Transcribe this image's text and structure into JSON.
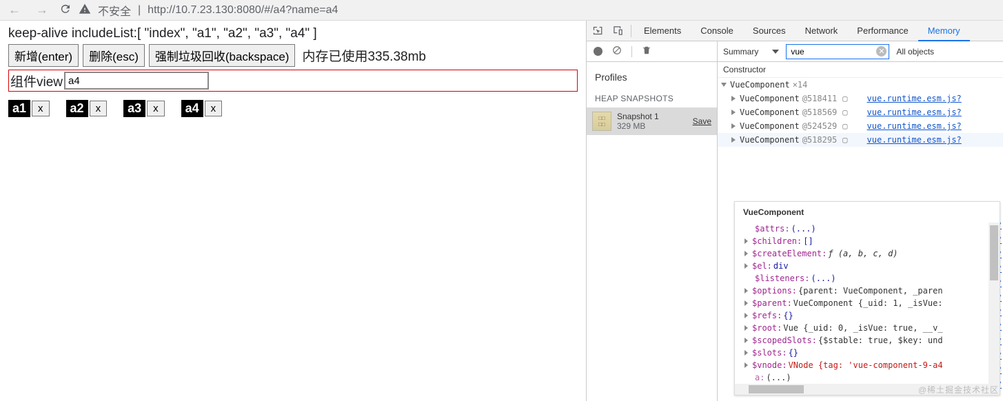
{
  "browser": {
    "url_security": "不安全",
    "url": "http://10.7.23.130:8080/#/a4?name=a4"
  },
  "page": {
    "includeList_text": "keep-alive includeList:[ \"index\", \"a1\", \"a2\", \"a3\", \"a4\" ]",
    "buttons": {
      "add": "新增(enter)",
      "del": "删除(esc)",
      "gc": "强制垃圾回收(backspace)"
    },
    "memory_text": "内存已使用335.38mb",
    "view_label": "组件view",
    "view_value": "a4",
    "tags": [
      {
        "label": "a1",
        "close": "x"
      },
      {
        "label": "a2",
        "close": "x"
      },
      {
        "label": "a3",
        "close": "x"
      },
      {
        "label": "a4",
        "close": "x"
      }
    ]
  },
  "devtools": {
    "tabs": [
      "Elements",
      "Console",
      "Sources",
      "Network",
      "Performance",
      "Memory"
    ],
    "active_tab": "Memory",
    "left": {
      "profiles": "Profiles",
      "heap_label": "HEAP SNAPSHOTS",
      "snapshot": {
        "name": "Snapshot 1",
        "size": "329 MB",
        "save": "Save"
      }
    },
    "right": {
      "summary": "Summary",
      "filter": "vue",
      "all_objects": "All objects",
      "constructor_header": "Constructor",
      "top": {
        "name": "VueComponent",
        "count": "×14"
      },
      "items": [
        {
          "name": "VueComponent",
          "id": "@518411",
          "link": "vue.runtime.esm.js?"
        },
        {
          "name": "VueComponent",
          "id": "@518569",
          "link": "vue.runtime.esm.js?"
        },
        {
          "name": "VueComponent",
          "id": "@524529",
          "link": "vue.runtime.esm.js?"
        },
        {
          "name": "VueComponent",
          "id": "@518295",
          "link": "vue.runtime.esm.js?"
        }
      ],
      "extra_links": [
        "s?",
        "s?",
        "s?",
        "s?",
        "s?",
        "s?",
        "s?",
        "s?",
        "s?",
        "s?",
        "s?",
        "s?"
      ],
      "object": {
        "title": "VueComponent",
        "props": [
          {
            "k": "$attrs",
            "v": "(...)",
            "arrow": false
          },
          {
            "k": "$children",
            "v": "[]",
            "arrow": true
          },
          {
            "k": "$createElement",
            "v": "ƒ (a, b, c, d)",
            "cls": "fn",
            "arrow": true
          },
          {
            "k": "$el",
            "v": "div",
            "cls": "val",
            "arrow": true
          },
          {
            "k": "$listeners",
            "v": "(...)",
            "arrow": false
          },
          {
            "k": "$options",
            "v": "{parent: VueComponent, _paren",
            "cls": "plain",
            "arrow": true
          },
          {
            "k": "$parent",
            "v": "VueComponent {_uid: 1, _isVue:",
            "cls": "plain",
            "arrow": true
          },
          {
            "k": "$refs",
            "v": "{}",
            "arrow": true
          },
          {
            "k": "$root",
            "v": "Vue {_uid: 0, _isVue: true, __v_",
            "cls": "plain",
            "arrow": true
          },
          {
            "k": "$scopedSlots",
            "v": "{$stable: true, $key: und",
            "cls": "plain",
            "arrow": true
          },
          {
            "k": "$slots",
            "v": "{}",
            "arrow": true
          },
          {
            "k": "$vnode",
            "v": "VNode {tag: 'vue-component-9-a4",
            "cls": "str",
            "arrow": true
          },
          {
            "k": "a",
            "v": "(...)",
            "cls": "plain",
            "arrow": false,
            "faded": true
          }
        ]
      }
    }
  },
  "watermark": "@稀土掘金技术社区"
}
